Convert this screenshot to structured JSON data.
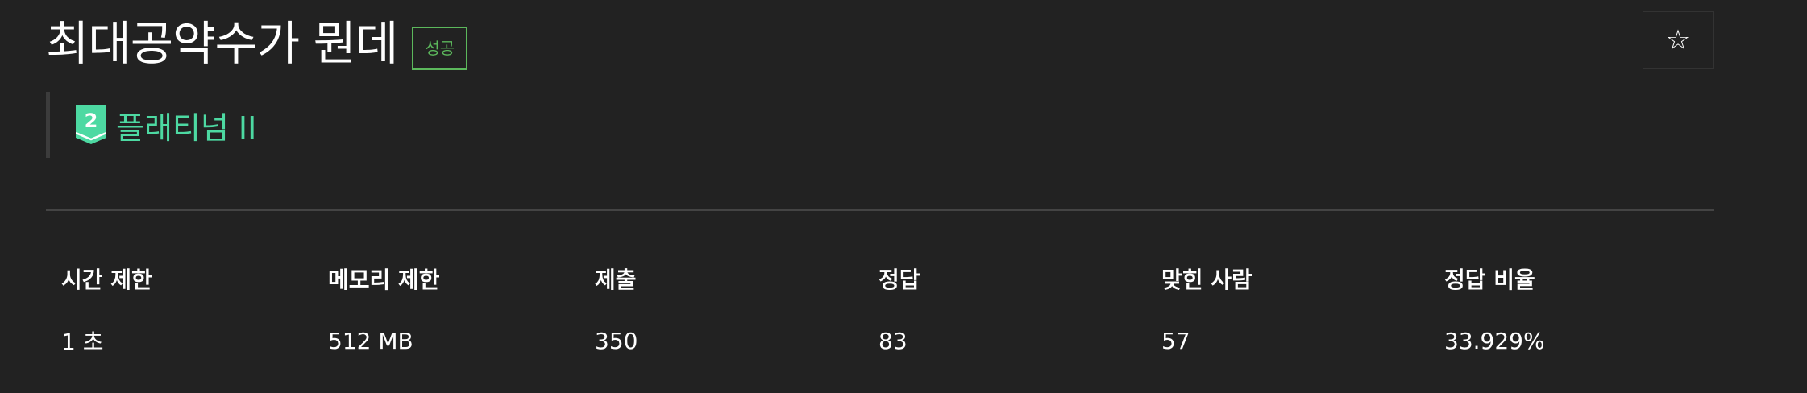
{
  "problem": {
    "title": "최대공약수가 뭔데",
    "status_badge": "성공",
    "star_icon": "☆",
    "tier": {
      "label": "플래티넘 II",
      "number": "2",
      "color": "#4dd9a2"
    }
  },
  "info_table": {
    "headers": [
      "시간 제한",
      "메모리 제한",
      "제출",
      "정답",
      "맞힌 사람",
      "정답 비율"
    ],
    "values": [
      "1 초",
      "512 MB",
      "350",
      "83",
      "57",
      "33.929%"
    ]
  },
  "colors": {
    "background": "#222222",
    "success": "#5cb85c",
    "tier": "#4dd9a2"
  }
}
